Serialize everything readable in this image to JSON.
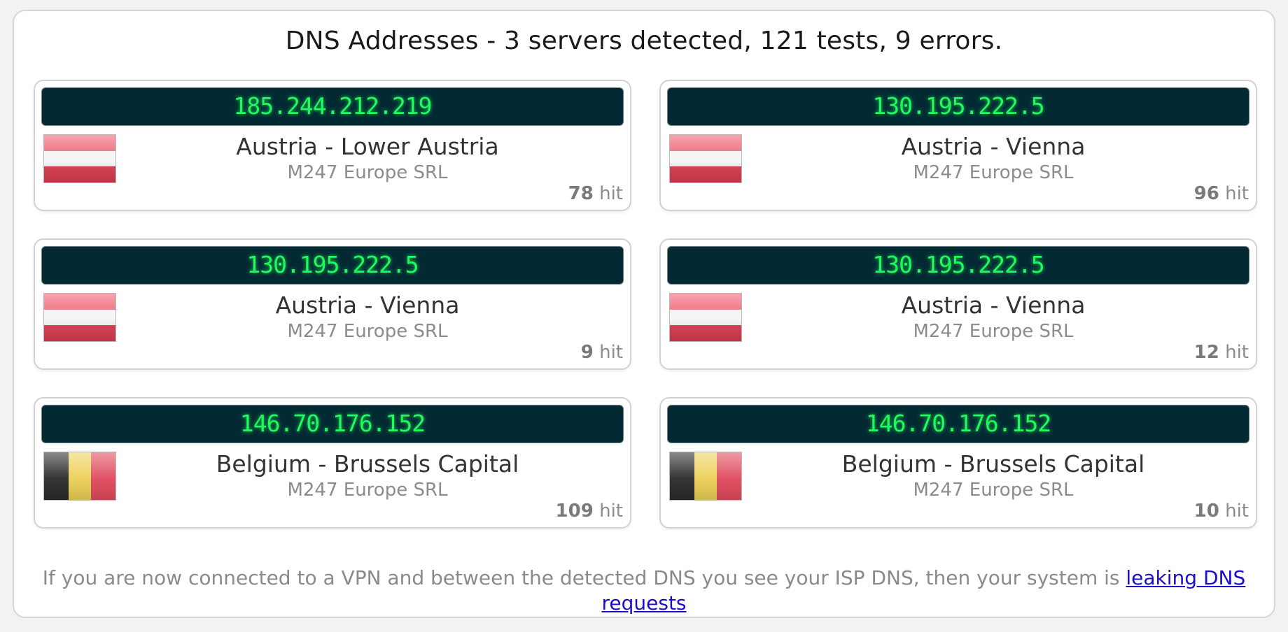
{
  "title": "DNS Addresses - 3 servers detected, 121 tests, 9 errors.",
  "colors": {
    "ip_bar_bg": "#032a33",
    "ip_text": "#1dfc5a",
    "link": "#1a0dcc"
  },
  "servers": [
    {
      "ip": "185.244.212.219",
      "flag_icon": "austria-flag-icon",
      "location": "Austria - Lower Austria",
      "isp": "M247 Europe SRL",
      "hits": "78",
      "hit_label": "hit"
    },
    {
      "ip": "130.195.222.5",
      "flag_icon": "austria-flag-icon",
      "location": "Austria - Vienna",
      "isp": "M247 Europe SRL",
      "hits": "96",
      "hit_label": "hit"
    },
    {
      "ip": "130.195.222.5",
      "flag_icon": "austria-flag-icon",
      "location": "Austria - Vienna",
      "isp": "M247 Europe SRL",
      "hits": "9",
      "hit_label": "hit"
    },
    {
      "ip": "130.195.222.5",
      "flag_icon": "austria-flag-icon",
      "location": "Austria - Vienna",
      "isp": "M247 Europe SRL",
      "hits": "12",
      "hit_label": "hit"
    },
    {
      "ip": "146.70.176.152",
      "flag_icon": "belgium-flag-icon",
      "location": "Belgium - Brussels Capital",
      "isp": "M247 Europe SRL",
      "hits": "109",
      "hit_label": "hit"
    },
    {
      "ip": "146.70.176.152",
      "flag_icon": "belgium-flag-icon",
      "location": "Belgium - Brussels Capital",
      "isp": "M247 Europe SRL",
      "hits": "10",
      "hit_label": "hit"
    }
  ],
  "footer": {
    "text": "If you are now connected to a VPN and between the detected DNS you see your ISP DNS, then your system is ",
    "link_text": "leaking DNS requests"
  }
}
